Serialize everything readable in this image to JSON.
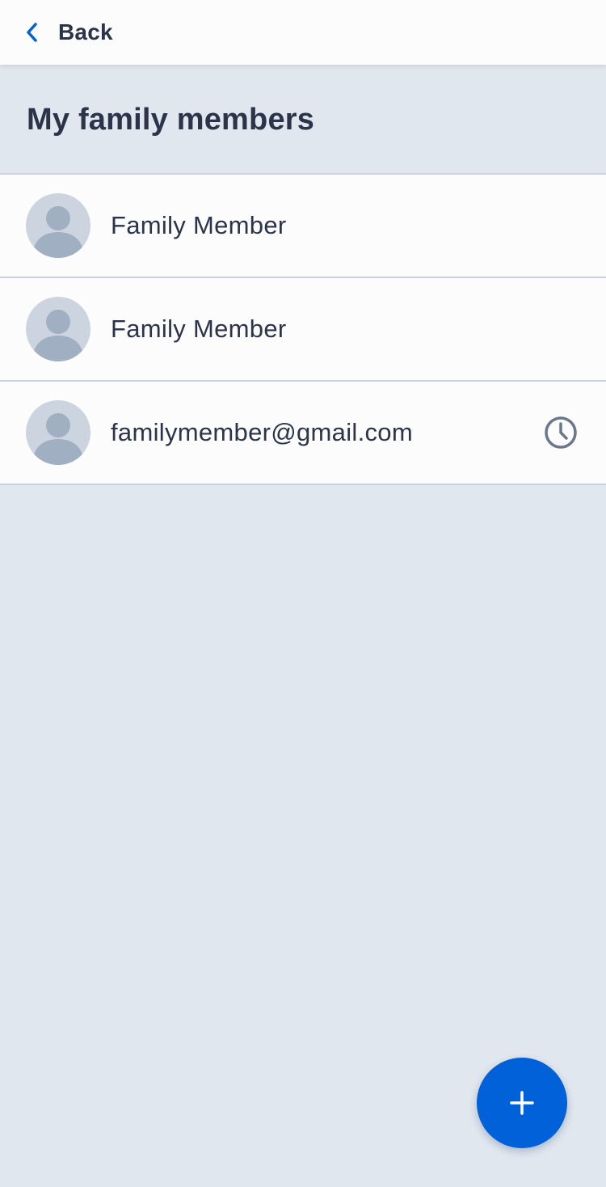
{
  "header": {
    "back_label": "Back"
  },
  "page": {
    "title": "My family members"
  },
  "members": [
    {
      "name": "Family Member",
      "status_icon": ""
    },
    {
      "name": "Family Member",
      "status_icon": ""
    },
    {
      "name": "familymember@gmail.com",
      "status_icon": "clock-icon"
    }
  ],
  "fab": {
    "icon": "plus-icon"
  },
  "colors": {
    "accent": "#0061d8",
    "text_primary": "#2b3448",
    "background": "#e1e7ef",
    "surface": "#fcfcfd",
    "divider": "#c9d3df",
    "avatar_bg": "#cbd4df",
    "avatar_figure": "#a1afc2",
    "icon_muted": "#6b778a"
  }
}
